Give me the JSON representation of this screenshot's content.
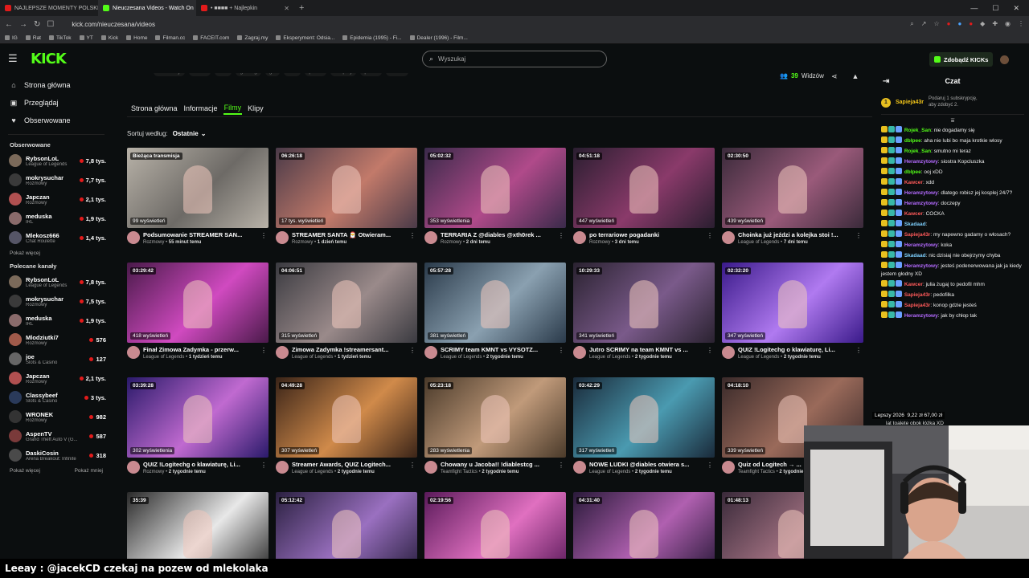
{
  "browser": {
    "tabs": [
      {
        "title": "NAJLEPSZE MOMENTY POLSKIEGO",
        "active": false,
        "color": "#e21b1b"
      },
      {
        "title": "Nieuczesana Videos - Watch On",
        "active": true,
        "color": "#53fc18"
      },
      {
        "title": "• ■■■■ + Najlepkin",
        "active": false,
        "color": "#e21b1b"
      }
    ],
    "url": "kick.com/nieuczesana/videos",
    "bookmarks": [
      "IG",
      "Rat",
      "TikTok",
      "YT",
      "Kick",
      "Home",
      "Filman.cc",
      "FACEIT.com",
      "Zagraj.my",
      "Eksperyment: Odsia...",
      "Epidemia (1995) - Fi...",
      "Dealer (1996) - Film..."
    ]
  },
  "topbar": {
    "logo": "KICK",
    "search_placeholder": "Wyszukaj",
    "kicks_button": "Zdobądź KICKs"
  },
  "sidebar": {
    "nav": [
      {
        "label": "Strona główna",
        "icon": "home-icon",
        "glyph": "⌂"
      },
      {
        "label": "Przeglądaj",
        "icon": "browse-icon",
        "glyph": "▣"
      },
      {
        "label": "Obserwowane",
        "icon": "heart-icon",
        "glyph": "♥"
      }
    ],
    "followed_title": "Obserwowane",
    "followed": [
      {
        "name": "RybsonLoL",
        "category": "League of Legends",
        "viewers": "7,8 tys.",
        "color": "#7b6a5a"
      },
      {
        "name": "mokrysuchar",
        "category": "Rozmowy",
        "viewers": "7,7 tys.",
        "color": "#3a3a3a"
      },
      {
        "name": "Japczan",
        "category": "Rozmowy",
        "viewers": "2,1 tys.",
        "color": "#b05050"
      },
      {
        "name": "meduska",
        "category": "IRL",
        "viewers": "1,9 tys.",
        "color": "#8a6b6b"
      },
      {
        "name": "Mlekosz666",
        "category": "Chat Roulette",
        "viewers": "1,4 tys.",
        "color": "#555566"
      }
    ],
    "followed_more": "Pokaż więcej",
    "recommended_title": "Polecane kanały",
    "recommended": [
      {
        "name": "RybsonLoL",
        "category": "League of Legends",
        "viewers": "7,8 tys.",
        "color": "#7b6a5a"
      },
      {
        "name": "mokrysuchar",
        "category": "Rozmowy",
        "viewers": "7,5 tys.",
        "color": "#3a3a3a"
      },
      {
        "name": "meduska",
        "category": "IRL",
        "viewers": "1,9 tys.",
        "color": "#8a6b6b"
      },
      {
        "name": "Mlodziutki7",
        "category": "Rozmowy",
        "viewers": "576",
        "color": "#a05a4a"
      },
      {
        "name": "joe",
        "category": "Slots & Casino",
        "viewers": "127",
        "color": "#666666"
      },
      {
        "name": "Japczan",
        "category": "Rozmowy",
        "viewers": "2,1 tys.",
        "color": "#b05050"
      },
      {
        "name": "Classybeef",
        "category": "Slots & Casino",
        "viewers": "3 tys.",
        "color": "#2a3a5a"
      },
      {
        "name": "WRONEK",
        "category": "Rozmowy",
        "viewers": "982",
        "color": "#333333"
      },
      {
        "name": "AspenTV",
        "category": "Grand Theft Auto V (G...",
        "viewers": "587",
        "color": "#7a3a3a"
      },
      {
        "name": "DaskiCosin",
        "category": "Arena Breakout: Infinite",
        "viewers": "318",
        "color": "#4a4a4a"
      }
    ],
    "recommended_more": "Pokaż więcej",
    "recommended_less": "Pokaż mniej"
  },
  "channel": {
    "tags": [
      "Rozmowy",
      "Polish",
      "chill",
      "gaming",
      "girl",
      "feet",
      "polish",
      "cosplay",
      "polski",
      "cobbo"
    ],
    "viewers_count": "39",
    "viewers_label": "Widzów",
    "tabs": [
      "Strona główna",
      "Informacje",
      "Filmy",
      "Klipy"
    ],
    "active_tab": "Filmy",
    "sort_label": "Sortuj według:",
    "sort_value": "Ostatnie"
  },
  "videos": [
    {
      "duration": "Bieżąca transmisja",
      "views": "99 wyświetleń",
      "title": "Podsumowanie STREAMER SAN...",
      "category": "Rozmowy",
      "age": "55 minut temu",
      "c1": "#b8b2a8",
      "c2": "#6d6a66"
    },
    {
      "duration": "06:26:18",
      "views": "17 tys. wyświetleń",
      "title": "STREAMER SANTA 🎅 Otwieram...",
      "category": "Rozmowy",
      "age": "1 dzień temu",
      "c1": "#4a3a48",
      "c2": "#c27a6a"
    },
    {
      "duration": "05:02:32",
      "views": "353 wyświetlenia",
      "title": "TERRARIA Z @diables @xth0rek ...",
      "category": "Rozmowy",
      "age": "2 dni temu",
      "c1": "#3a2a4a",
      "c2": "#b04a8a"
    },
    {
      "duration": "04:51:18",
      "views": "447 wyświetleń",
      "title": "po terrariowe pogadanki",
      "category": "Rozmowy",
      "age": "3 dni temu",
      "c1": "#2a1e30",
      "c2": "#8a3a6a"
    },
    {
      "duration": "02:30:50",
      "views": "439 wyświetleń",
      "title": "Choinka już jeździ a kolejka stoi !...",
      "category": "League of Legends",
      "age": "7 dni temu",
      "c1": "#3a2a3a",
      "c2": "#9a5a7a"
    },
    {
      "duration": "03:29:42",
      "views": "418 wyświetleń",
      "title": "Finał Zimowa Zadymka - przerw...",
      "category": "League of Legends",
      "age": "1 tydzień temu",
      "c1": "#4a1a4a",
      "c2": "#d04ac0"
    },
    {
      "duration": "04:06:51",
      "views": "315 wyświetleń",
      "title": "Zimowa Zadymka !streamersant...",
      "category": "League of Legends",
      "age": "1 tydzień temu",
      "c1": "#3a3a40",
      "c2": "#9a8a8a"
    },
    {
      "duration": "05:57:28",
      "views": "381 wyświetleń",
      "title": "SCRIMY team KMNT vs VYSOTZ...",
      "category": "League of Legends",
      "age": "2 tygodnie temu",
      "c1": "#2a3a4a",
      "c2": "#8aa0b0"
    },
    {
      "duration": "10:29:33",
      "views": "341 wyświetleń",
      "title": "Jutro SCRIMY na team KMNT vs ...",
      "category": "League of Legends",
      "age": "2 tygodnie temu",
      "c1": "#2a2230",
      "c2": "#7a5a8a"
    },
    {
      "duration": "02:32:20",
      "views": "347 wyświetleń",
      "title": "QUIZ !Logitechg o klawiaturę, Li...",
      "category": "League of Legends",
      "age": "2 tygodnie temu",
      "c1": "#3a1a8a",
      "c2": "#b07af0"
    },
    {
      "duration": "03:39:28",
      "views": "302 wyświetlenia",
      "title": "QUIZ !Logitechg o klawiaturę, Li...",
      "category": "Rozmowy",
      "age": "2 tygodnie temu",
      "c1": "#2a1a6a",
      "c2": "#c06ad0"
    },
    {
      "duration": "04:49:28",
      "views": "307 wyświetleń",
      "title": "Streamer Awards, QUIZ Logitech...",
      "category": "League of Legends",
      "age": "2 tygodnie temu",
      "c1": "#3a2418",
      "c2": "#d08a4a"
    },
    {
      "duration": "05:23:18",
      "views": "283 wyświetlenia",
      "title": "Chowany u Jacoba!! !diablestcg ...",
      "category": "Teamfight Tactics",
      "age": "2 tygodnie temu",
      "c1": "#4a3a2a",
      "c2": "#c09a7a"
    },
    {
      "duration": "03:42:29",
      "views": "317 wyświetleń",
      "title": "NOWE LUDKI @diables otwiera s...",
      "category": "League of Legends",
      "age": "2 tygodnie temu",
      "c1": "#1a2a3a",
      "c2": "#4a9ab0"
    },
    {
      "duration": "04:18:10",
      "views": "339 wyświetleń",
      "title": "Quiz od Logitech → ...",
      "category": "Teamfight Tactics",
      "age": "2 tygodnie temu",
      "c1": "#3a2a2a",
      "c2": "#9a6a5a"
    },
    {
      "duration": "35:39",
      "views": "",
      "title": "",
      "category": "",
      "age": "",
      "c1": "#2a2a2a",
      "c2": "#e8e8e8"
    },
    {
      "duration": "05:12:42",
      "views": "",
      "title": "",
      "category": "",
      "age": "",
      "c1": "#2a2040",
      "c2": "#9a70c0"
    },
    {
      "duration": "02:19:56",
      "views": "",
      "title": "",
      "category": "",
      "age": "",
      "c1": "#5a1a5a",
      "c2": "#e070c0"
    },
    {
      "duration": "04:31:40",
      "views": "",
      "title": "",
      "category": "",
      "age": "",
      "c1": "#2a1a3a",
      "c2": "#b060b0"
    },
    {
      "duration": "01:48:13",
      "views": "",
      "title": "",
      "category": "",
      "age": "",
      "c1": "#3a2a3a",
      "c2": "#a07080"
    }
  ],
  "chat": {
    "title": "Czat",
    "pinned_user": "Sapieja43r",
    "pinned_text": "Podaruj 1 subskrypcję, aby zdobyć 2.",
    "messages": [
      {
        "user": "Rojek_San",
        "color": "#53fc18",
        "text": "nie dogadamy się"
      },
      {
        "user": "dbIpee",
        "color": "#53fc18",
        "text": "aha nie lubi bo maja krotkie wlosy"
      },
      {
        "user": "Rojek_San",
        "color": "#53fc18",
        "text": "smutno mi teraz"
      },
      {
        "user": "Heramzytowy",
        "color": "#b46aff",
        "text": "siostra Kopcluszka"
      },
      {
        "user": "dbIpee",
        "color": "#53fc18",
        "text": "ooj xDD"
      },
      {
        "user": "Kawcer",
        "color": "#ff5a5a",
        "text": "xdd"
      },
      {
        "user": "Heramzytowy",
        "color": "#b46aff",
        "text": "dlatego robisz jej kosplej 24/7?"
      },
      {
        "user": "Heramzytowy",
        "color": "#b46aff",
        "text": "doczepy"
      },
      {
        "user": "Kawcer",
        "color": "#ff5a5a",
        "text": "COCKA"
      },
      {
        "user": "Skadaad",
        "color": "#7fd1ff",
        "text": ""
      },
      {
        "user": "Sapieja43r",
        "color": "#ff5a5a",
        "text": "my napewno gadamy o włosach?"
      },
      {
        "user": "Heramzytowy",
        "color": "#b46aff",
        "text": "koka"
      },
      {
        "user": "Skadaad",
        "color": "#7fd1ff",
        "text": "nic dzisiaj nie obejrzymy chyba"
      },
      {
        "user": "Heramzytowy",
        "color": "#b46aff",
        "text": "jesteś podenerwowana jak ja kiedy jestem głodny XD"
      },
      {
        "user": "Kawcer",
        "color": "#ff5a5a",
        "text": "julia żugaj to pedofil mhm"
      },
      {
        "user": "Sapieja43r",
        "color": "#ff5a5a",
        "text": "pedofilka"
      },
      {
        "user": "Sapieja43r",
        "color": "#ff5a5a",
        "text": "konop gdzie jesteś"
      },
      {
        "user": "Heramzytowy",
        "color": "#b46aff",
        "text": "jak by chłop tak"
      }
    ]
  },
  "overlay": {
    "ticker": "Lepszy 2026",
    "ticker_value": "9,22 zł    67,00 zł",
    "ticker_line2": "lat toalete obok łóżka XD",
    "caption": "Leeay : @jacekCD czekaj na pozew od mlekolaka"
  },
  "colors": {
    "accent": "#53fc18",
    "background": "#0b0e0f",
    "live": "#e21b1b"
  }
}
